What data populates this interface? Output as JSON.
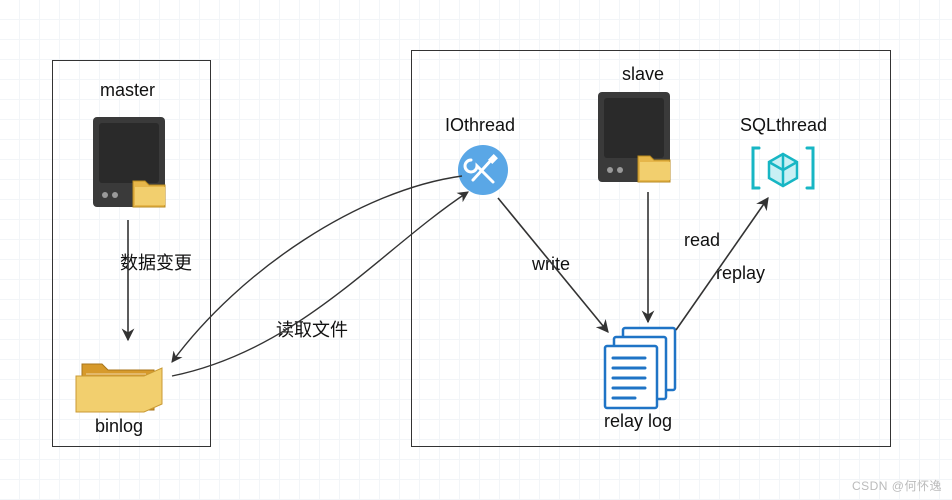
{
  "diagram": {
    "master": {
      "title": "master",
      "binlog": "binlog",
      "arrow_label": "数据变更"
    },
    "slave": {
      "title": "slave",
      "iothread": "IOthread",
      "sqlthread": "SQLthread",
      "relaylog": "relay log"
    },
    "edges": {
      "read_file": "读取文件",
      "write": "write",
      "read": "read",
      "replay": "replay"
    }
  },
  "watermark": "CSDN @何怀逸"
}
